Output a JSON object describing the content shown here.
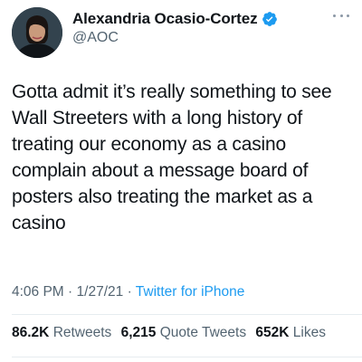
{
  "tweet": {
    "author": {
      "display_name": "Alexandria Ocasio-Cortez",
      "handle": "@AOC",
      "verified_icon": "verified-badge-icon",
      "avatar_icon": "avatar"
    },
    "text": "Gotta admit it’s really something to see Wall Streeters with a long history of treating our economy as a casino complain about a message board of posters also treating the market as a casino",
    "time": "4:06 PM",
    "sep1": "·",
    "date": "1/27/21",
    "sep2": "·",
    "source": "Twitter for iPhone",
    "stats": {
      "retweets_count": "86.2K",
      "retweets_label": "Retweets",
      "quote_count": "6,215",
      "quote_label": "Quote Tweets",
      "likes_count": "652K",
      "likes_label": "Likes"
    },
    "colors": {
      "accent": "#1d9bf0",
      "secondary_text": "#536471",
      "primary_text": "#0f1419"
    }
  }
}
